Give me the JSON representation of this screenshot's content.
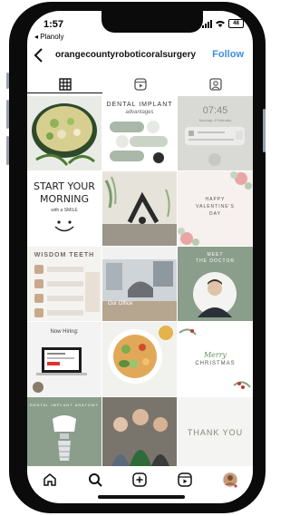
{
  "status_bar": {
    "time": "1:57",
    "back_app": "◂ Planoly",
    "battery": "48"
  },
  "header": {
    "username": "orangecountyroboticoralsurgery",
    "follow_label": "Follow"
  },
  "tabs": [
    {
      "icon": "grid-icon",
      "selected": true
    },
    {
      "icon": "reels-icon",
      "selected": false
    },
    {
      "icon": "tagged-icon",
      "selected": false
    }
  ],
  "posts": {
    "p2": {
      "line1": "DENTAL IMPLANT",
      "line2": "advantages"
    },
    "p3": {
      "time": "07:45",
      "date": "Monday, 4 February"
    },
    "p4": {
      "line1": "START YOUR",
      "line2": "MORNING",
      "line3": "with a SMILE"
    },
    "p6": {
      "line1": "HAPPY",
      "line2": "VALENTINE'S",
      "line3": "DAY"
    },
    "p7": {
      "title": "WISDOM TEETH"
    },
    "p8": {
      "label": "Our Office"
    },
    "p9": {
      "line1": "MEET",
      "line2": "THE DOCTOR"
    },
    "p10": {
      "title": "Now Hiring:"
    },
    "p12": {
      "line1": "Merry",
      "line2": "CHRISTMAS"
    },
    "p13": {
      "title": "DENTAL IMPLANT ANATOMY"
    },
    "p15": {
      "text": "THANK YOU"
    }
  },
  "nav": [
    {
      "icon": "home-icon"
    },
    {
      "icon": "search-icon"
    },
    {
      "icon": "create-icon"
    },
    {
      "icon": "reels-icon"
    },
    {
      "icon": "profile-avatar"
    }
  ],
  "colors": {
    "follow": "#3a8fdc",
    "sage": "#8a9e8b",
    "beige": "#d8c7b3"
  }
}
